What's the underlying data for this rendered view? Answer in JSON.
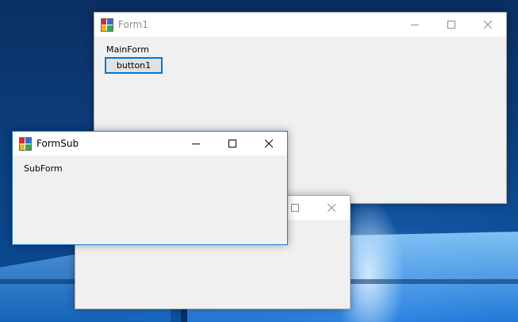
{
  "colors": {
    "accent": "#0078d7",
    "window_bg": "#f0f0f0",
    "titlebar_bg": "#ffffff"
  },
  "form1": {
    "title": "Form1",
    "label": "MainForm",
    "button_label": "button1",
    "icons": [
      "minimize-icon",
      "maximize-icon",
      "close-icon"
    ]
  },
  "form3": {
    "title": "",
    "icons": [
      "maximize-icon",
      "close-icon"
    ]
  },
  "formsub": {
    "title": "FormSub",
    "label": "SubForm",
    "icons": [
      "minimize-icon",
      "maximize-icon",
      "close-icon"
    ]
  }
}
